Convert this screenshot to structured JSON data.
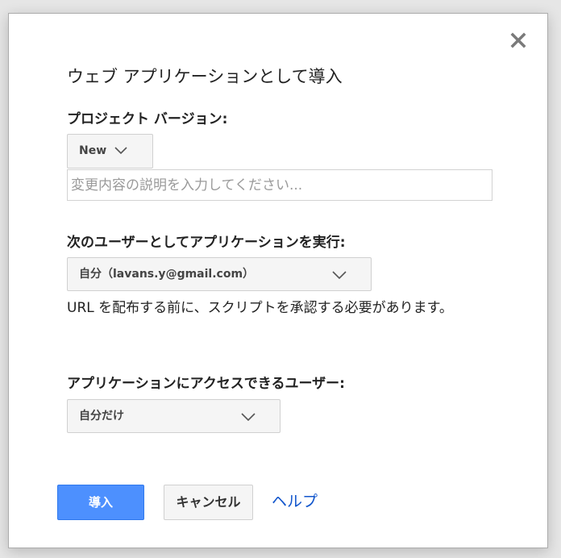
{
  "dialog": {
    "title": "ウェブ アプリケーションとして導入",
    "close_label": "×"
  },
  "project_version": {
    "label": "プロジェクト バージョン:",
    "selected": "New",
    "description_placeholder": "変更内容の説明を入力してください..."
  },
  "execute_as": {
    "label": "次のユーザーとしてアプリケーションを実行:",
    "selected": "自分（lavans.y@gmail.com）",
    "note": "URL を配布する前に、スクリプトを承認する必要があります。"
  },
  "access": {
    "label": "アプリケーションにアクセスできるユーザー:",
    "selected": "自分だけ"
  },
  "buttons": {
    "deploy": "導入",
    "cancel": "キャンセル",
    "help": "ヘルプ"
  },
  "colors": {
    "primary": "#4d90fe",
    "link": "#1155cc"
  }
}
